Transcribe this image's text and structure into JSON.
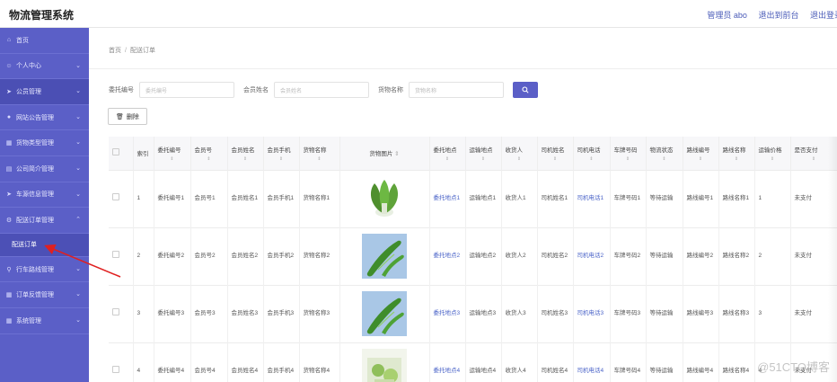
{
  "header": {
    "title": "物流管理系统",
    "user": "管理员 abo",
    "back": "退出到前台",
    "logout": "退出登录"
  },
  "sidebar": {
    "items": [
      {
        "label": "首页",
        "icon": "home-icon"
      },
      {
        "label": "个人中心",
        "icon": "user-icon"
      },
      {
        "label": "公员管理",
        "icon": "send-icon"
      },
      {
        "label": "网站公告管理",
        "icon": "circle-icon"
      },
      {
        "label": "货物类型管理",
        "icon": "grid-icon"
      },
      {
        "label": "公司简介管理",
        "icon": "book-icon"
      },
      {
        "label": "车源信息管理",
        "icon": "send-icon"
      },
      {
        "label": "配送订单管理",
        "icon": "gear-icon"
      }
    ],
    "sub_active": "配送订单",
    "items_after": [
      {
        "label": "行车路线管理",
        "icon": "pin-icon"
      },
      {
        "label": "订单反馈管理",
        "icon": "grid-icon"
      },
      {
        "label": "系统管理",
        "icon": "grid-icon"
      }
    ]
  },
  "breadcrumb": {
    "home": "首页",
    "sep": "/",
    "current": "配送订单"
  },
  "search": {
    "label1": "委托编号",
    "ph1": "委托编号",
    "label2": "会员姓名",
    "ph2": "会员姓名",
    "label3": "货物名称",
    "ph3": "货物名称"
  },
  "delete_label": "删除",
  "table": {
    "headers": [
      "",
      "索引",
      "委托编号",
      "会员号",
      "会员姓名",
      "会员手机",
      "货物名称",
      "货物图片",
      "委托地点",
      "运输地点",
      "收货人",
      "司机姓名",
      "司机电话",
      "车牌号码",
      "物流状态",
      "路线编号",
      "路线名称",
      "运输价格",
      "是否支付"
    ],
    "rows": [
      [
        "1",
        "委托编号1",
        "会员号1",
        "会员姓名1",
        "会员手机1",
        "货物名称1",
        "bokchoy",
        "委托地点1",
        "运输地点1",
        "收货人1",
        "司机姓名1",
        "司机电话1",
        "车牌号码1",
        "等待运输",
        "路线编号1",
        "路线名称1",
        "1",
        "未支付"
      ],
      [
        "2",
        "委托编号2",
        "会员号2",
        "会员姓名2",
        "会员手机2",
        "货物名称2",
        "cucumber",
        "委托地点2",
        "运输地点2",
        "收货人2",
        "司机姓名2",
        "司机电话2",
        "车牌号码2",
        "等待运输",
        "路线编号2",
        "路线名称2",
        "2",
        "未支付"
      ],
      [
        "3",
        "委托编号3",
        "会员号3",
        "会员姓名3",
        "会员手机3",
        "货物名称3",
        "cucumber",
        "委托地点3",
        "运输地点3",
        "收货人3",
        "司机姓名3",
        "司机电话3",
        "车牌号码3",
        "等待运输",
        "路线编号3",
        "路线名称3",
        "3",
        "未支付"
      ],
      [
        "4",
        "委托编号4",
        "会员号4",
        "会员姓名4",
        "会员手机4",
        "货物名称4",
        "greens",
        "委托地点4",
        "运输地点4",
        "收货人4",
        "司机姓名4",
        "司机电话4",
        "车牌号码4",
        "等待运输",
        "路线编号4",
        "路线名称4",
        "4",
        "未支付"
      ]
    ]
  },
  "watermark": "@51CTO博客",
  "colors": {
    "sidebar": "#5b5fc7",
    "accent": "#4a63c8",
    "arrow": "#e02020"
  }
}
